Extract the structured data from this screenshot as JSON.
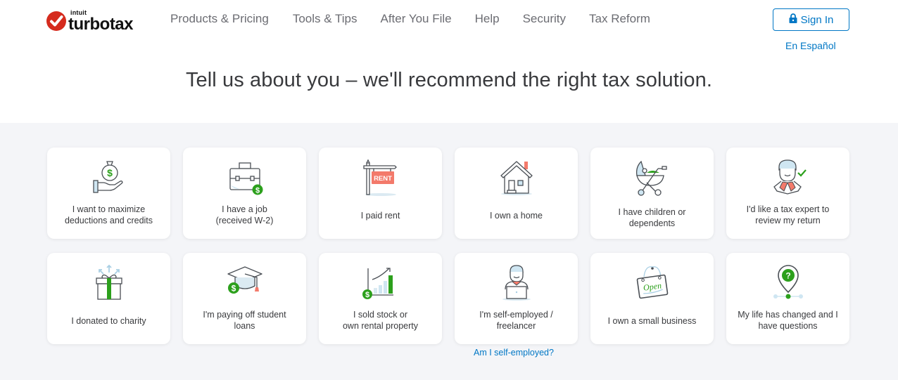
{
  "brand": {
    "parent": "intuit",
    "name": "turbotax",
    "accent": "#d52b1e",
    "link_color": "#0077c5",
    "success_color": "#2ca01c"
  },
  "nav": {
    "items": [
      {
        "label": "Products & Pricing"
      },
      {
        "label": "Tools & Tips"
      },
      {
        "label": "After You File"
      },
      {
        "label": "Help"
      },
      {
        "label": "Security"
      },
      {
        "label": "Tax Reform"
      }
    ]
  },
  "account": {
    "sign_in_label": "Sign In",
    "sign_in_icon": "lock-icon",
    "language_link": "En Español"
  },
  "headline": "Tell us about you – we'll recommend the right tax solution.",
  "cards": [
    {
      "label": "I want to maximize deductions and credits",
      "icon": "money-bag-hand-icon"
    },
    {
      "label": "I have a job (received W-2)",
      "icon": "briefcase-dollar-icon"
    },
    {
      "label": "I paid rent",
      "icon": "rent-sign-icon"
    },
    {
      "label": "I own a home",
      "icon": "house-icon"
    },
    {
      "label": "I have children or dependents",
      "icon": "stroller-icon"
    },
    {
      "label": "I'd like a tax expert to review my return",
      "icon": "tax-expert-icon"
    },
    {
      "label": "I donated to charity",
      "icon": "gift-icon"
    },
    {
      "label": "I'm paying off student loans",
      "icon": "graduation-cap-icon"
    },
    {
      "label": "I sold stock or own rental property",
      "icon": "growth-chart-icon"
    },
    {
      "label": "I'm self-employed / freelancer",
      "icon": "freelancer-laptop-icon"
    },
    {
      "label": "I own a small business",
      "icon": "open-sign-icon"
    },
    {
      "label": "My life has changed and I have questions",
      "icon": "location-question-icon"
    }
  ],
  "card_lines": [
    [
      "I want to maximize",
      "deductions and credits"
    ],
    [
      "I have a job",
      "(received W-2)"
    ],
    [
      "I paid rent"
    ],
    [
      "I own a home"
    ],
    [
      "I have children or",
      "dependents"
    ],
    [
      "I'd like a tax expert to",
      "review my return"
    ],
    [
      "I donated to charity"
    ],
    [
      "I'm paying off student",
      "loans"
    ],
    [
      "I sold stock or",
      "own rental property"
    ],
    [
      "I'm self-employed /",
      "freelancer"
    ],
    [
      "I own a small business"
    ],
    [
      "My life has changed and I",
      "have questions"
    ]
  ],
  "self_employed_link": "Am I self-employed?",
  "open_sign_text": "Open",
  "rent_sign_text": "RENT"
}
